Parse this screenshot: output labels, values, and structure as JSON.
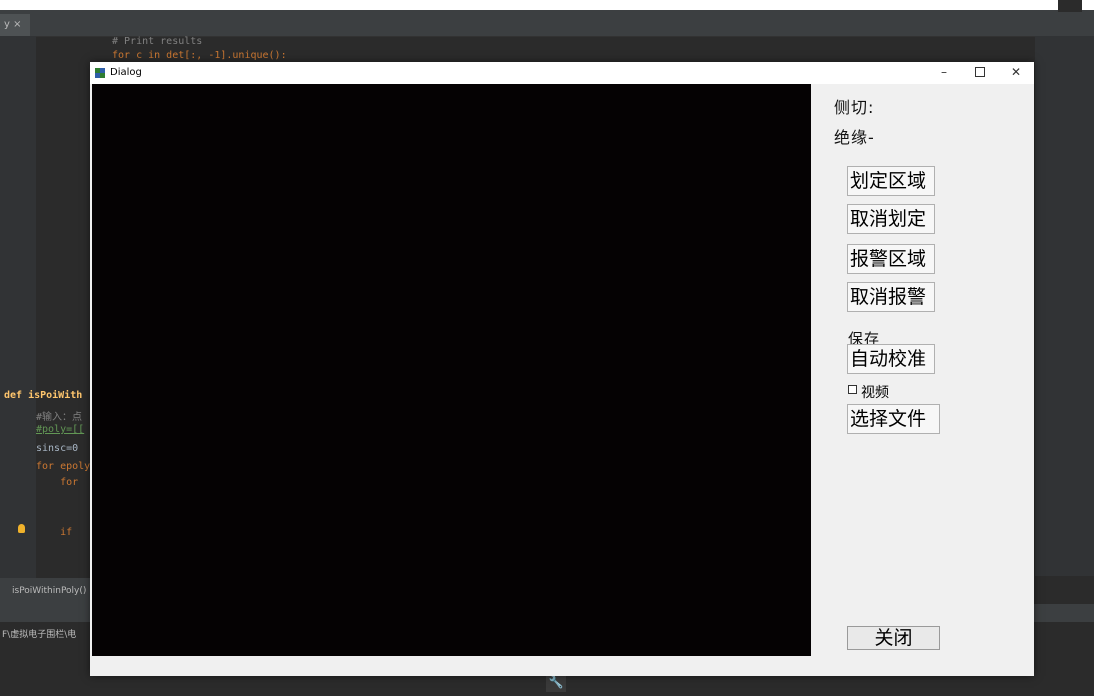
{
  "ide": {
    "tab_label": "y ×",
    "code_lines": [
      {
        "text": "# Print results",
        "cls": "c-comment"
      },
      {
        "text": "for c in det[:, -1].unique():",
        "cls": "c-key"
      }
    ],
    "def_line": "def isPoiWith",
    "gutter_lines": [
      {
        "text": "#输入：点",
        "cls": "c-comment"
      },
      {
        "text": "#poly=[[",
        "cls": "c-cmt2"
      },
      {
        "text": "sinsc=0 ",
        "cls": "c-plain"
      },
      {
        "text": "for epoly",
        "cls": "c-key"
      },
      {
        "text": "    for ",
        "cls": "c-key"
      },
      {
        "text": "    if ",
        "cls": "c-key"
      }
    ],
    "status_func": "isPoiWithinPoly()",
    "path_text": "F\\虚拟电子围栏\\电"
  },
  "dialog": {
    "title": "Dialog",
    "labels": {
      "detection": "侧切:",
      "crossing": "绝缘-",
      "save": "保存"
    },
    "buttons": {
      "set_region": "划定区域",
      "cancel_draw": "取消划定",
      "alarm_region": "报警区域",
      "cancel_alarm": "取消报警",
      "calibration": "自动校准",
      "select_file": "选择文件",
      "close": "关闭"
    },
    "checkbox_label": "视频"
  }
}
